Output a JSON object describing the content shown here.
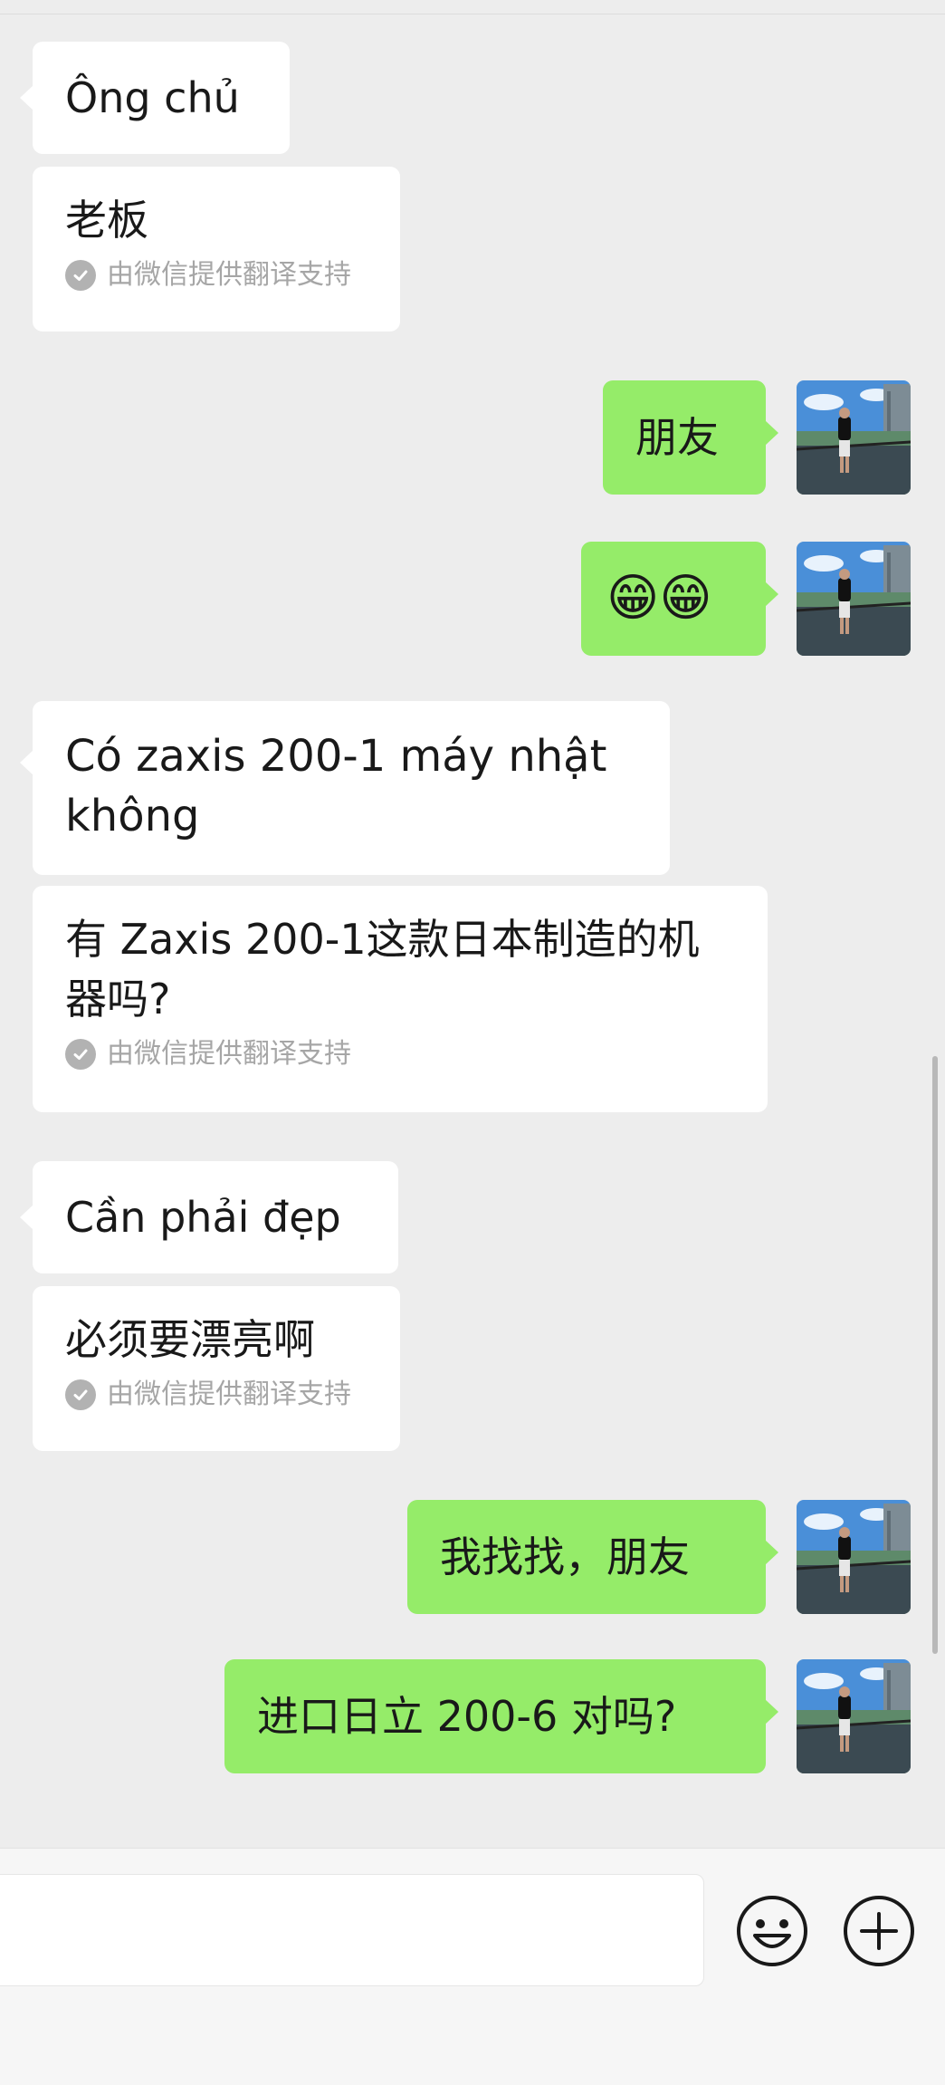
{
  "messages": {
    "m1": "Ông chủ",
    "m1_translation": "老板",
    "m2": "朋友",
    "m3": "😁😁",
    "m4": "Có zaxis 200-1 máy nhật không",
    "m4_translation": "有 Zaxis 200-1这款日本制造的机器吗?",
    "m5": "Cần phải đẹp",
    "m5_translation": "必须要漂亮啊",
    "m6": "我找找，朋友",
    "m7": "进口日立 200-6 对吗?"
  },
  "translation_attribution": "由微信提供翻译支持",
  "colors": {
    "sent_bubble": "#95ec69",
    "received_bubble": "#ffffff",
    "background": "#ededed"
  },
  "icons": {
    "emoji_button": "emoji-face-icon",
    "more_button": "plus-circle-icon"
  }
}
